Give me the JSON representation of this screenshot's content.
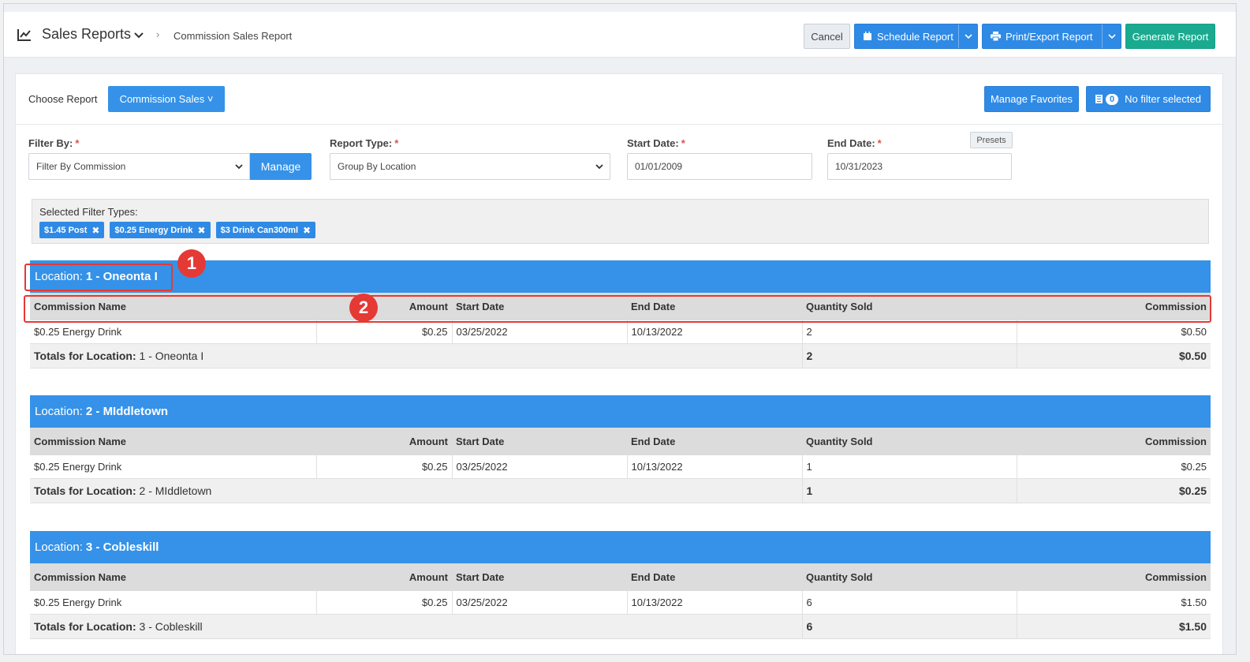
{
  "header": {
    "title": "Sales Reports",
    "breadcrumb": "Commission Sales Report",
    "cancel_label": "Cancel",
    "schedule_label": "Schedule Report",
    "print_label": "Print/Export Report",
    "generate_label": "Generate Report"
  },
  "toolbar": {
    "choose_label": "Choose Report",
    "report_value": "Commission Sales ˅",
    "manage_favorites_label": "Manage Favorites",
    "filter_count": "0",
    "filter_status": "No filter selected"
  },
  "filters": {
    "filter_by_label": "Filter By:",
    "filter_by_value": "Filter By Commission",
    "manage_label": "Manage",
    "report_type_label": "Report Type:",
    "report_type_value": "Group By Location",
    "start_label": "Start Date:",
    "start_value": "01/01/2009",
    "end_label": "End Date:",
    "end_value": "10/31/2023",
    "presets_label": "Presets",
    "required_mark": "*",
    "selected_types_label": "Selected Filter Types:",
    "chips": [
      "$1.45 Post",
      "$0.25 Energy Drink",
      "$3 Drink Can300ml"
    ],
    "chip_remove": "✖"
  },
  "columns": [
    "Commission Name",
    "Amount",
    "Start Date",
    "End Date",
    "Quantity Sold",
    "Commission"
  ],
  "locations": [
    {
      "prefix": "Location:",
      "name": "1 - Oneonta I",
      "row": [
        "$0.25 Energy Drink",
        "$0.25",
        "03/25/2022",
        "10/13/2022",
        "2",
        "$0.50"
      ],
      "totals_label": "Totals for Location:",
      "totals_name": "1 - Oneonta I",
      "total_qty": "2",
      "total_commission": "$0.50"
    },
    {
      "prefix": "Location:",
      "name": "2 - MIddletown",
      "row": [
        "$0.25 Energy Drink",
        "$0.25",
        "03/25/2022",
        "10/13/2022",
        "1",
        "$0.25"
      ],
      "totals_label": "Totals for Location:",
      "totals_name": "2 - MIddletown",
      "total_qty": "1",
      "total_commission": "$0.25"
    },
    {
      "prefix": "Location:",
      "name": "3 - Cobleskill",
      "row": [
        "$0.25 Energy Drink",
        "$0.25",
        "03/25/2022",
        "10/13/2022",
        "6",
        "$1.50"
      ],
      "totals_label": "Totals for Location:",
      "totals_name": "3 - Cobleskill",
      "total_qty": "6",
      "total_commission": "$1.50"
    }
  ],
  "annotations": {
    "marker1": "1",
    "marker2": "2"
  },
  "colors": {
    "primary": "#2f8ae5",
    "accent_green": "#1aaa8f",
    "highlight_red": "#e53935"
  }
}
